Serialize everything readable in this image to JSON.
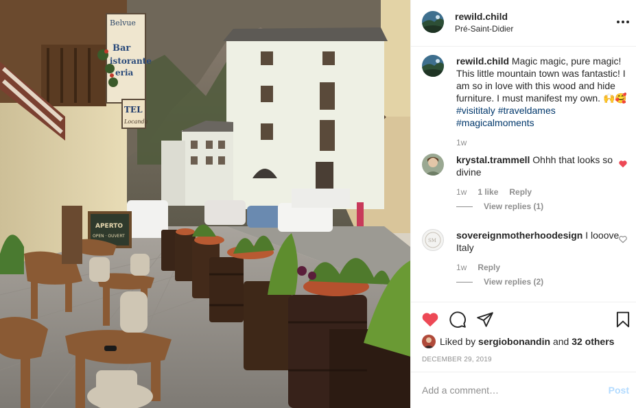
{
  "post": {
    "username": "rewild.child",
    "location": "Pré-Saint-Didier"
  },
  "caption": {
    "username": "rewild.child",
    "text": "Magic magic, pure magic! This little mountain town was fantastic! I am so in love with this wood and hide furniture. I must manifest my own. 🙌🥰",
    "hashtags": [
      "#visititaly",
      "#traveldames",
      "#magicalmoments"
    ],
    "age": "1w"
  },
  "comments": [
    {
      "username": "krystal.trammell",
      "text": "Ohhh that looks so divine",
      "age": "1w",
      "likes": "1 like",
      "reply_label": "Reply",
      "view_replies": "View replies (1)",
      "liked": true
    },
    {
      "username": "sovereignmotherhoodesign",
      "text": "I looove Italy",
      "age": "1w",
      "reply_label": "Reply",
      "view_replies": "View replies (2)",
      "liked": false
    }
  ],
  "likes": {
    "prefix": "Liked by",
    "user": "sergiobonandin",
    "joiner": "and",
    "others": "32 others"
  },
  "date": "DECEMBER 29, 2019",
  "add_comment": {
    "placeholder": "Add a comment…",
    "post_label": "Post"
  },
  "photo_signs": {
    "bar_sign": [
      "Bar",
      "istorante",
      "eria"
    ],
    "top_sign": "Belvue",
    "hotel_sign": "TEL",
    "hotel_sub": "Locanda",
    "aperto": "APERTO",
    "aperto_sub": "OPEN · OUVERT"
  },
  "colors": {
    "heart_red": "#ed4956",
    "hashtag_blue": "#00376b",
    "muted": "#8e8e8e",
    "post_disabled": "#b3dbff"
  },
  "icons": {
    "more": "more-horizontal-icon",
    "like": "heart-icon",
    "comment": "comment-icon",
    "share": "share-icon",
    "save": "bookmark-icon"
  }
}
